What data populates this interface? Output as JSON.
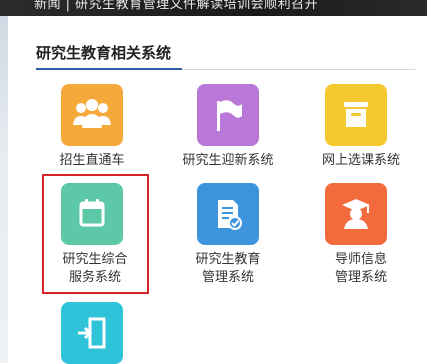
{
  "banner": {
    "text": "新闻 | 研究生教育管理文件解读培训会顺利召开"
  },
  "section": {
    "title": "研究生教育相关系统"
  },
  "systems": [
    {
      "label": "招生直通车",
      "color": "#f5a93a"
    },
    {
      "label": "研究生迎新系统",
      "color": "#b978d8"
    },
    {
      "label": "网上选课系统",
      "color": "#f3c92f"
    },
    {
      "label_line1": "研究生综合",
      "label_line2": "服务系统",
      "color": "#5cc8a8"
    },
    {
      "label_line1": "研究生教育",
      "label_line2": "管理系统",
      "color": "#3d94dd"
    },
    {
      "label_line1": "导师信息",
      "label_line2": "管理系统",
      "color": "#f36a3d"
    },
    {
      "label": "",
      "color": "#2ec3d8"
    }
  ],
  "highlight_color": "#d8252a"
}
